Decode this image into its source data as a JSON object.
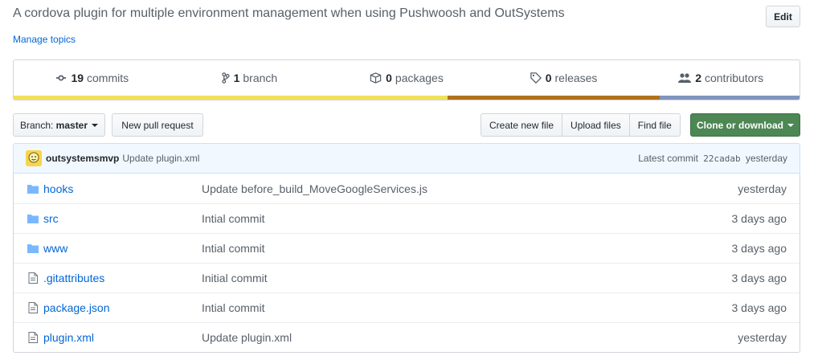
{
  "repo": {
    "description": "A cordova plugin for multiple environment management when using Pushwoosh and OutSystems",
    "manage_topics": "Manage topics",
    "edit_label": "Edit"
  },
  "stats": [
    {
      "icon": "commits-icon",
      "count": "19",
      "label": "commits"
    },
    {
      "icon": "branch-icon",
      "count": "1",
      "label": "branch"
    },
    {
      "icon": "package-icon",
      "count": "0",
      "label": "packages"
    },
    {
      "icon": "tag-icon",
      "count": "0",
      "label": "releases"
    },
    {
      "icon": "people-icon",
      "count": "2",
      "label": "contributors"
    }
  ],
  "language_bar": [
    {
      "color": "#f1e05a",
      "fraction": 0.552
    },
    {
      "color": "#b07219",
      "fraction": 0.27
    },
    {
      "color": "#8294bd",
      "fraction": 0.178
    }
  ],
  "toolbar": {
    "branch_prefix": "Branch:",
    "branch_name": "master",
    "new_pr": "New pull request",
    "create_file": "Create new file",
    "upload_files": "Upload files",
    "find_file": "Find file",
    "clone": "Clone or download"
  },
  "latest_commit": {
    "author": "outsystemsmvp",
    "message": "Update plugin.xml",
    "prefix": "Latest commit",
    "sha": "22cadab",
    "age": "yesterday"
  },
  "files": [
    {
      "type": "folder",
      "name": "hooks",
      "message": "Update before_build_MoveGoogleServices.js",
      "age": "yesterday"
    },
    {
      "type": "folder",
      "name": "src",
      "message": "Intial commit",
      "age": "3 days ago"
    },
    {
      "type": "folder",
      "name": "www",
      "message": "Intial commit",
      "age": "3 days ago"
    },
    {
      "type": "file",
      "name": ".gitattributes",
      "message": "Initial commit",
      "age": "3 days ago"
    },
    {
      "type": "file",
      "name": "package.json",
      "message": "Intial commit",
      "age": "3 days ago"
    },
    {
      "type": "file",
      "name": "plugin.xml",
      "message": "Update plugin.xml",
      "age": "yesterday"
    }
  ],
  "colors": {
    "link": "#0366d6",
    "folder_icon": "#79b8ff",
    "clone_button": "#4d8754"
  }
}
